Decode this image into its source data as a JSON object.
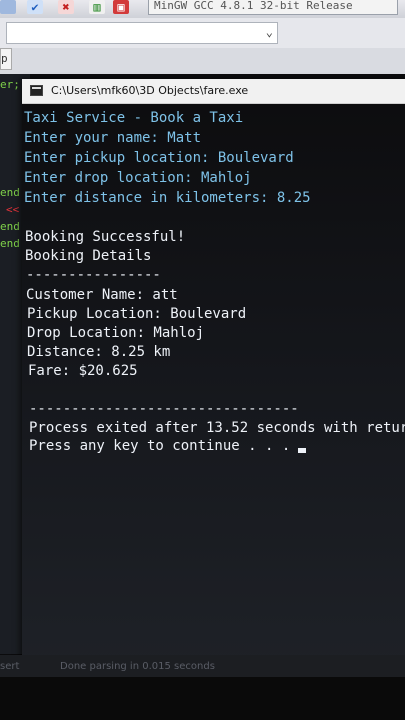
{
  "ide": {
    "compiler_select": "MinGW GCC 4.8.1 32-bit Release",
    "tab_label": "p",
    "code_fragments": [
      "er;",
      "end",
      "<<",
      "end",
      "end"
    ],
    "status_left": "sert",
    "status_message": "Done parsing in 0.015 seconds"
  },
  "console": {
    "title": "C:\\Users\\mfk60\\3D Objects\\fare.exe",
    "input_lines": [
      "Taxi Service - Book a Taxi",
      "Enter your name: Matt",
      "Enter pickup location: Boulevard",
      "Enter drop location: Mahloj",
      "Enter distance in kilometers: 8.25"
    ],
    "output_lines": [
      "Booking Successful!",
      "Booking Details",
      "----------------",
      "Customer Name: att",
      "Pickup Location: Boulevard",
      "Drop Location: Mahloj",
      "Distance: 8.25 km",
      "Fare: $20.625"
    ],
    "separator": "--------------------------------",
    "exit_message": "Process exited after 13.52 seconds with retur",
    "continue_prompt": "Press any key to continue . . ."
  },
  "colors": {
    "input_text": "#7ec2e8",
    "output_text": "#eef2f8",
    "ide_keyword_green": "#7fd14a",
    "ide_keyword_red": "#e0333a"
  }
}
